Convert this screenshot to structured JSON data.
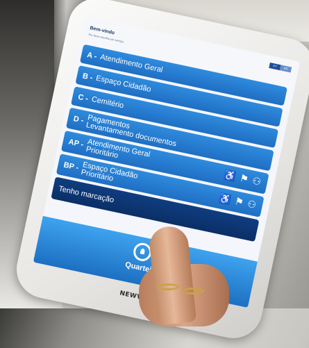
{
  "header": {
    "welcome": "Bem-vindo",
    "subtitle": "Por favor escolha um serviço",
    "lang_options": [
      "PT",
      "EN"
    ]
  },
  "menu": {
    "items": [
      {
        "code": "A -",
        "lines": [
          "Atendimento Geral"
        ],
        "priority": false
      },
      {
        "code": "B -",
        "lines": [
          "Espaço Cidadão"
        ],
        "priority": false
      },
      {
        "code": "C -",
        "lines": [
          "Cemitério"
        ],
        "priority": false
      },
      {
        "code": "D -",
        "lines": [
          "Pagamentos",
          "Levantamento documentos"
        ],
        "priority": false
      },
      {
        "code": "AP -",
        "lines": [
          "Atendimento Geral",
          "Prioritário"
        ],
        "priority": true
      },
      {
        "code": "BP -",
        "lines": [
          "Espaço Cidadão",
          "Prioritário"
        ],
        "priority": true
      }
    ],
    "appointment_label": "Tenho marcação",
    "priority_icon_glyphs": "♿🤰👨‍👧"
  },
  "footer": {
    "logo_text": "Quarteira"
  },
  "device": {
    "brand": "NEWVISION"
  },
  "colors": {
    "button_blue": "#1f6fc4",
    "button_dark": "#0b2f66",
    "footer_blue": "#2b8ee0"
  }
}
